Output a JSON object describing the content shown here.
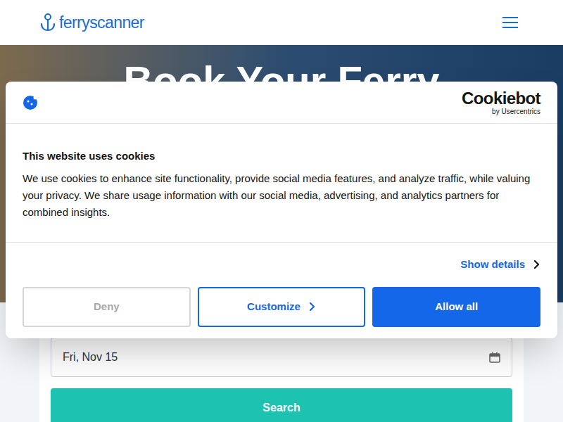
{
  "header": {
    "logo": "ferryscanner"
  },
  "hero": {
    "title": "Book Your Ferry"
  },
  "search_form": {
    "date": "Fri, Nov 15",
    "button": "Search"
  },
  "cookie_dialog": {
    "brand": "Cookiebot",
    "brand_sub": "by Usercentrics",
    "title": "This website uses cookies",
    "text": "We use cookies to enhance site functionality, provide social media features, and analyze traffic, while valuing your privacy. We share usage information with our social media, advertising, and analytics partners for combined insights.",
    "show_details": "Show details",
    "buttons": [
      {
        "label": "Deny",
        "kind": "muted"
      },
      {
        "label": "Customize",
        "kind": "outline"
      },
      {
        "label": "Allow all",
        "kind": "primary"
      }
    ]
  }
}
